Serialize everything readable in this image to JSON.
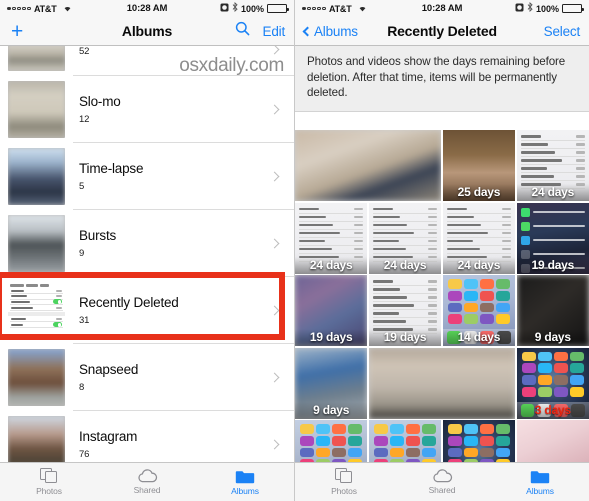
{
  "watermark": "osxdaily.com",
  "status_bar": {
    "carrier": "AT&T",
    "time": "10:28 AM",
    "battery_percent": "100%",
    "signal_dots_filled": 1,
    "signal_dots_total": 5,
    "icons": [
      "wifi-icon",
      "alarm-icon",
      "bluetooth-icon",
      "battery-icon"
    ]
  },
  "left_panel": {
    "nav": {
      "add_label": "+",
      "title": "Albums",
      "search_label": "search-icon",
      "edit_label": "Edit"
    },
    "albums": [
      {
        "name": "",
        "count": "52",
        "thumb": "th-a",
        "partial": true
      },
      {
        "name": "Slo-mo",
        "count": "12",
        "thumb": "th-b",
        "partial": false
      },
      {
        "name": "Time-lapse",
        "count": "5",
        "thumb": "th-c",
        "partial": false
      },
      {
        "name": "Bursts",
        "count": "9",
        "thumb": "th-d",
        "partial": false
      },
      {
        "name": "Recently Deleted",
        "count": "31",
        "thumb": "th-settings",
        "partial": false,
        "highlighted": true
      },
      {
        "name": "Snapseed",
        "count": "8",
        "thumb": "th-e",
        "partial": false
      },
      {
        "name": "Instagram",
        "count": "76",
        "thumb": "th-f",
        "partial": false
      }
    ],
    "highlight_color": "#e8311a",
    "tabs": [
      {
        "label": "Photos",
        "icon": "photos-icon",
        "active": false
      },
      {
        "label": "Shared",
        "icon": "cloud-icon",
        "active": false
      },
      {
        "label": "Albums",
        "icon": "albums-folder-icon",
        "active": true
      }
    ]
  },
  "right_panel": {
    "nav": {
      "back_label": "Albums",
      "title": "Recently Deleted",
      "select_label": "Select"
    },
    "info_text": "Photos and videos show the days remaining before deletion. After that time, items will be permanently deleted.",
    "grid": [
      {
        "days": "",
        "art": "g-room",
        "span": 2,
        "blurred": true,
        "overlay": "none"
      },
      {
        "days": "25 days",
        "art": "g-glass",
        "span": 1,
        "blurred": false,
        "overlay": "none"
      },
      {
        "days": "24 days",
        "art": "g-settings",
        "span": 1,
        "blurred": false,
        "overlay": "settings"
      },
      {
        "days": "24 days",
        "art": "g-settings",
        "span": 1,
        "blurred": false,
        "overlay": "settings"
      },
      {
        "days": "24 days",
        "art": "g-settings",
        "span": 1,
        "blurred": false,
        "overlay": "settings"
      },
      {
        "days": "24 days",
        "art": "g-settings",
        "span": 1,
        "blurred": false,
        "overlay": "settings"
      },
      {
        "days": "19 days",
        "art": "g-lockdark",
        "span": 1,
        "blurred": false,
        "overlay": "notifs"
      },
      {
        "days": "19 days",
        "art": "g-blurhome",
        "span": 1,
        "blurred": true,
        "overlay": "none"
      },
      {
        "days": "19 days",
        "art": "g-settings",
        "span": 1,
        "blurred": false,
        "overlay": "settings"
      },
      {
        "days": "14 days",
        "art": "g-apps",
        "span": 1,
        "blurred": false,
        "overlay": "apps"
      },
      {
        "days": "9 days",
        "art": "g-dark",
        "span": 1,
        "blurred": true,
        "overlay": "none"
      },
      {
        "days": "9 days",
        "art": "g-blue",
        "span": 1,
        "blurred": true,
        "overlay": "none"
      },
      {
        "days": "",
        "art": "g-wide",
        "span": 2,
        "blurred": true,
        "overlay": "none"
      },
      {
        "days": "3 days",
        "art": "g-galaxy",
        "span": 1,
        "blurred": false,
        "overlay": "apps",
        "days_red": true
      },
      {
        "days": "",
        "art": "g-ihome",
        "span": 1,
        "blurred": false,
        "overlay": "apps"
      },
      {
        "days": "",
        "art": "g-ihome",
        "span": 1,
        "blurred": false,
        "overlay": "apps"
      },
      {
        "days": "",
        "art": "g-galaxy",
        "span": 1,
        "blurred": false,
        "overlay": "apps"
      },
      {
        "days": "",
        "art": "g-keyboard",
        "span": 1,
        "blurred": false,
        "overlay": "none"
      }
    ],
    "tabs": [
      {
        "label": "Photos",
        "icon": "photos-icon",
        "active": false
      },
      {
        "label": "Shared",
        "icon": "cloud-icon",
        "active": false
      },
      {
        "label": "Albums",
        "icon": "albums-folder-icon",
        "active": true
      }
    ]
  }
}
